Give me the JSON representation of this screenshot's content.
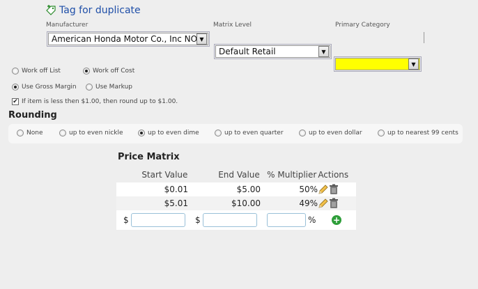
{
  "tag_link": {
    "label": "Tag for duplicate",
    "icon": "tag-plus-icon"
  },
  "fields": {
    "manufacturer": {
      "label": "Manufacturer",
      "value": "American Honda Motor Co., Inc NO"
    },
    "matrix_level": {
      "label": "Matrix Level",
      "value": "Default Retail"
    },
    "primary_category": {
      "label": "Primary Category",
      "value": "",
      "highlight": "#ffff00"
    }
  },
  "work_mode": {
    "option1": "Work off List",
    "option2": "Work off Cost",
    "selected": "Work off Cost"
  },
  "margin_mode": {
    "option1": "Use Gross Margin",
    "option2": "Use Markup",
    "selected": "Use Gross Margin"
  },
  "round_up_checkbox": {
    "label": "If item is less then $1.00, then round up to $1.00.",
    "checked": true
  },
  "rounding": {
    "title": "Rounding",
    "options": [
      "None",
      "up to even nickle",
      "up to even dime",
      "up to even quarter",
      "up to even dollar",
      "up to nearest 99 cents"
    ],
    "selected": "up to even dime"
  },
  "price_matrix": {
    "title": "Price Matrix",
    "headers": {
      "start": "Start Value",
      "end": "End Value",
      "multiplier": "% Multiplier",
      "actions": "Actions"
    },
    "rows": [
      {
        "start": "$0.01",
        "end": "$5.00",
        "multiplier": "50%"
      },
      {
        "start": "$5.01",
        "end": "$10.00",
        "multiplier": "49%"
      }
    ],
    "new_row": {
      "start_prefix": "$",
      "end_prefix": "$",
      "multiplier_suffix": "%",
      "start_value": "",
      "end_value": "",
      "multiplier_value": ""
    }
  },
  "colors": {
    "link": "#1f4fa8",
    "add_button": "#2e9e3a"
  }
}
